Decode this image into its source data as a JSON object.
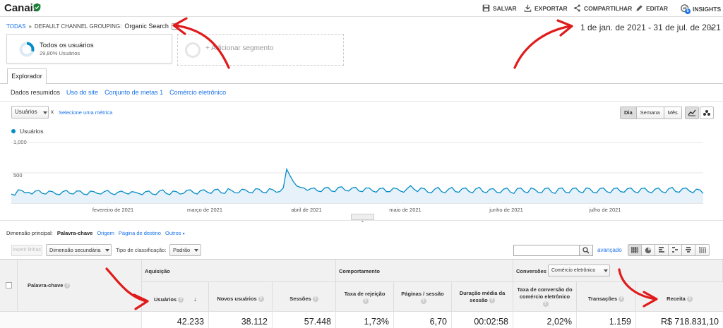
{
  "header": {
    "title": "Canais",
    "buttons": [
      {
        "label": "SALVAR",
        "icon": "save-icon"
      },
      {
        "label": "EXPORTAR",
        "icon": "export-icon"
      },
      {
        "label": "COMPARTILHAR",
        "icon": "share-icon"
      },
      {
        "label": "EDITAR",
        "icon": "edit-icon"
      },
      {
        "label": "INSIGHTS",
        "icon": "insights-icon",
        "badge": "5"
      }
    ]
  },
  "breadcrumb": {
    "root": "TODAS",
    "separator": "»",
    "grouping": "DEFAULT CHANNEL GROUPING:",
    "value": "Organic Search"
  },
  "date_range": "1 de jan. de 2021 - 31 de jul. de 2021",
  "segments": {
    "active": {
      "name": "Todos os usuários",
      "percent": "29,80% Usuários",
      "fraction": 0.298
    },
    "add_label": "+ Adicionar segmento"
  },
  "tabs": {
    "explorer": "Explorador",
    "subtabs": [
      "Dados resumidos",
      "Uso do site",
      "Conjunto de metas 1",
      "Comércio eletrônico"
    ]
  },
  "metric": {
    "selected": "Usuários",
    "remove": "x",
    "add": "Selecione uma métrica"
  },
  "time_buttons": [
    "Dia",
    "Semana",
    "Mês"
  ],
  "chart_data": {
    "type": "area",
    "series": [
      {
        "name": "Usuários",
        "color": "#058dc7"
      }
    ],
    "yticks": [
      "1,000",
      "500"
    ],
    "ylim": [
      0,
      1000
    ],
    "xticks": [
      "fevereiro de 2021",
      "março de 2021",
      "abril de 2021",
      "maio de 2021",
      "junho de 2021",
      "julho de 2021"
    ],
    "values": [
      150,
      130,
      220,
      210,
      170,
      180,
      150,
      200,
      210,
      160,
      150,
      200,
      190,
      150,
      140,
      190,
      210,
      160,
      150,
      200,
      200,
      150,
      140,
      200,
      190,
      160,
      150,
      190,
      210,
      160,
      140,
      180,
      200,
      170,
      150,
      190,
      180,
      160,
      140,
      190,
      200,
      150,
      140,
      200,
      220,
      160,
      140,
      200,
      190,
      150,
      160,
      210,
      220,
      170,
      150,
      210,
      220,
      180,
      160,
      220,
      230,
      170,
      160,
      240,
      210,
      170,
      170,
      230,
      220,
      180,
      170,
      240,
      230,
      180,
      170,
      240,
      220,
      180,
      190,
      250,
      560,
      450,
      350,
      280,
      260,
      250,
      210,
      240,
      250,
      200,
      190,
      250,
      260,
      200,
      190,
      260,
      270,
      210,
      200,
      250,
      260,
      200,
      190,
      250,
      250,
      200,
      180,
      240,
      250,
      190,
      190,
      250,
      240,
      200,
      180,
      240,
      290,
      230,
      190,
      250,
      240,
      180,
      170,
      230,
      260,
      190,
      170,
      230,
      260,
      190,
      180,
      240,
      250,
      190,
      170,
      240,
      260,
      190,
      170,
      230,
      240,
      180,
      170,
      230,
      250,
      180,
      160,
      240,
      250,
      190,
      170,
      250,
      230,
      180,
      170,
      240,
      250,
      180,
      160,
      240,
      250,
      180,
      170,
      240,
      250,
      190,
      170,
      250,
      240,
      180,
      170,
      240,
      250,
      190,
      170,
      240,
      250,
      190,
      180,
      240,
      250,
      190,
      170,
      240,
      250,
      190,
      170,
      230,
      250,
      190,
      170,
      240,
      260,
      190,
      180,
      240,
      250,
      200,
      170,
      230,
      220,
      160
    ]
  },
  "dimension": {
    "label": "Dimensão principal:",
    "active": "Palavra-chave",
    "options": [
      "Origem",
      "Página de destino",
      "Outros"
    ]
  },
  "controls": {
    "plot": "Inserir linhas",
    "secondary": "Dimensão secundária",
    "sort_label": "Tipo de classificação:",
    "sort_value": "Padrão",
    "advanced": "avançado"
  },
  "table": {
    "dimension_header": "Palavra-chave",
    "groups": {
      "acquisition": "Aquisição",
      "behavior": "Comportamento",
      "conversions": "Conversões",
      "conversion_dd": "Comércio eletrônico"
    },
    "columns": [
      {
        "label": "Usuários",
        "value": "42.233"
      },
      {
        "label": "Novos usuários",
        "value": "38.112"
      },
      {
        "label": "Sessões",
        "value": "57.448"
      },
      {
        "label": "Taxa de rejeição",
        "value": "1,73%"
      },
      {
        "label": "Páginas / sessão",
        "value": "6,70"
      },
      {
        "label": "Duração média da sessão",
        "value": "00:02:58"
      },
      {
        "label": "Taxa de conversão do comércio eletrônico",
        "value": "2,02%"
      },
      {
        "label": "Transações",
        "value": "1.159"
      },
      {
        "label": "Receita",
        "value": "R$ 718.831,10"
      }
    ]
  },
  "colors": {
    "accent": "#058dc7",
    "link": "#1a73e8",
    "annotation": "#e01b1b",
    "verified": "#188038"
  }
}
